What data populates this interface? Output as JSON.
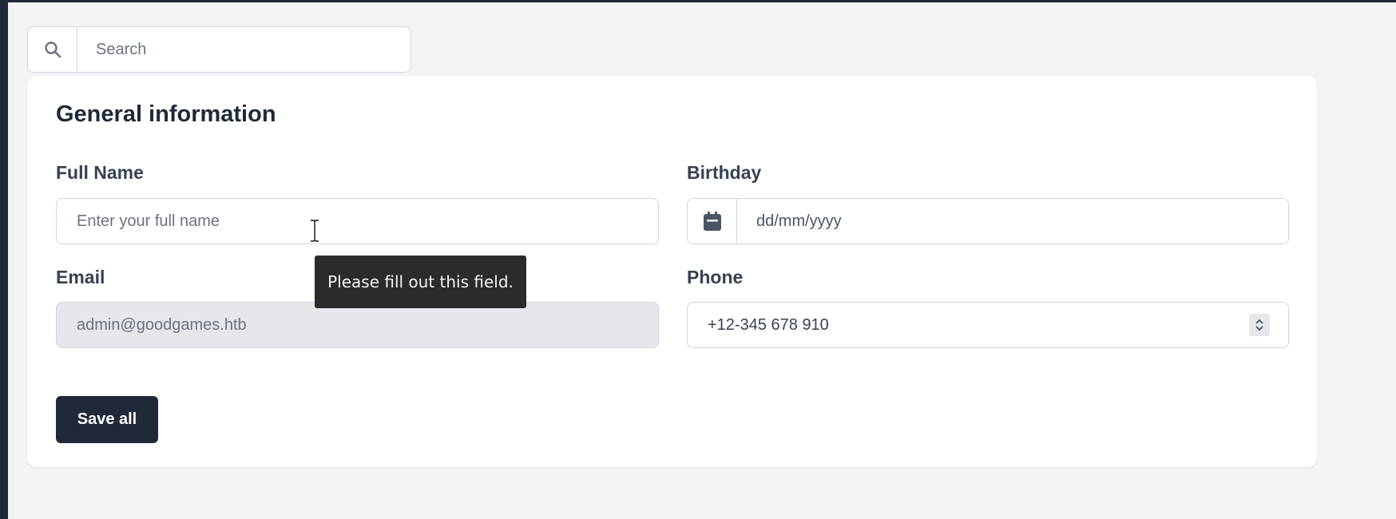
{
  "search": {
    "placeholder": "Search",
    "icon": "search-icon"
  },
  "card": {
    "title": "General information"
  },
  "fields": {
    "full_name": {
      "label": "Full Name",
      "placeholder": "Enter your full name",
      "value": ""
    },
    "birthday": {
      "label": "Birthday",
      "placeholder": "dd/mm/yyyy",
      "icon": "calendar-icon"
    },
    "email": {
      "label": "Email",
      "value": "admin@goodgames.htb",
      "disabled": true
    },
    "phone": {
      "label": "Phone",
      "value": "+12-345 678 910"
    }
  },
  "save_button": {
    "label": "Save all"
  },
  "tooltip": {
    "text": "Please fill out this field."
  },
  "colors": {
    "page_background": "#f3f4f6",
    "card_background": "#ffffff",
    "button_background": "#1f2937",
    "disabled_input": "#e5e7eb",
    "tooltip_background": "#2b2b2b"
  }
}
